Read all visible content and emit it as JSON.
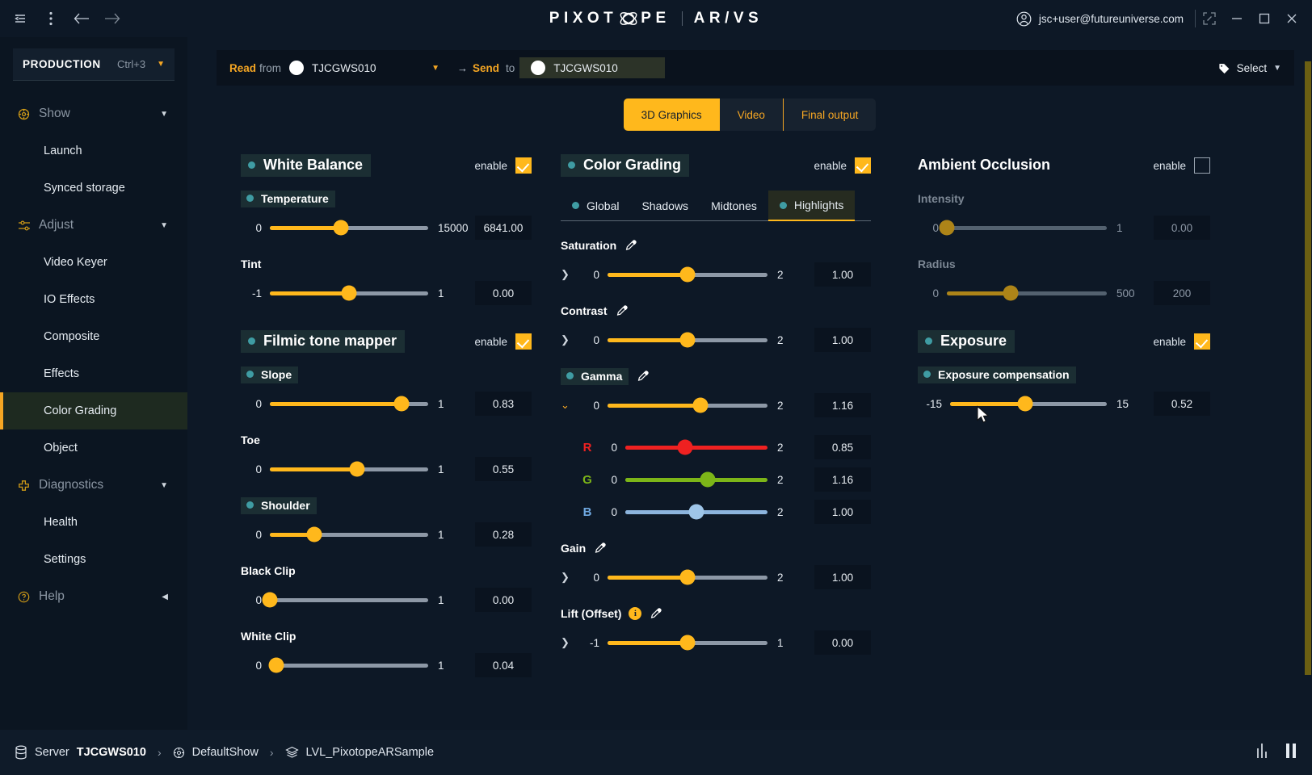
{
  "titlebar": {
    "collapse_icon": "collapse-panel-icon",
    "menu_icon": "kebab-menu-icon",
    "back_icon": "arrow-left-icon",
    "forward_icon": "arrow-right-icon",
    "logo_text": "PIXOT",
    "logo_text_tail": "PE",
    "logo_sub": "AR/VS",
    "user_email": "jsc+user@futureuniverse.com",
    "fullscreen_icon": "expand-icon",
    "minimize_icon": "minimize-icon",
    "maximize_icon": "maximize-icon",
    "close_icon": "close-icon"
  },
  "sidebar": {
    "production": {
      "label": "PRODUCTION",
      "shortcut": "Ctrl+3"
    },
    "groups": [
      {
        "label": "Show",
        "icon": "show-icon",
        "items": [
          "Launch",
          "Synced storage"
        ]
      },
      {
        "label": "Adjust",
        "icon": "sliders-icon",
        "items": [
          "Video Keyer",
          "IO Effects",
          "Composite",
          "Effects",
          "Color Grading",
          "Object"
        ]
      },
      {
        "label": "Diagnostics",
        "icon": "diagnostics-icon",
        "items": [
          "Health",
          "Settings"
        ]
      }
    ],
    "help": {
      "label": "Help",
      "icon": "help-icon"
    },
    "active_item": "Color Grading"
  },
  "topbar": {
    "read_from_label": "Read",
    "read_from_sub": "from",
    "read_from_value": "TJCGWS010",
    "arrow": "→",
    "send_to_label": "Send",
    "send_to_sub": "to",
    "send_to_value": "TJCGWS010",
    "select_label": "Select",
    "tag_icon": "tag-icon"
  },
  "view_tabs": [
    {
      "label": "3D Graphics",
      "active": true
    },
    {
      "label": "Video",
      "active": false
    },
    {
      "label": "Final output",
      "active": false
    }
  ],
  "white_balance": {
    "title": "White Balance",
    "enable_label": "enable",
    "enabled": true,
    "params": [
      {
        "name": "Temperature",
        "chip": true,
        "min": "0",
        "max": "15000",
        "value": "6841.00",
        "pct": 45
      },
      {
        "name": "Tint",
        "chip": false,
        "min": "-1",
        "max": "1",
        "value": "0.00",
        "pct": 50
      }
    ]
  },
  "filmic": {
    "title": "Filmic tone mapper",
    "enable_label": "enable",
    "enabled": true,
    "params": [
      {
        "name": "Slope",
        "chip": true,
        "min": "0",
        "max": "1",
        "value": "0.83",
        "pct": 83
      },
      {
        "name": "Toe",
        "chip": false,
        "min": "0",
        "max": "1",
        "value": "0.55",
        "pct": 55
      },
      {
        "name": "Shoulder",
        "chip": true,
        "min": "0",
        "max": "1",
        "value": "0.28",
        "pct": 28
      },
      {
        "name": "Black Clip",
        "chip": false,
        "min": "0",
        "max": "1",
        "value": "0.00",
        "pct": 0
      },
      {
        "name": "White Clip",
        "chip": false,
        "min": "0",
        "max": "1",
        "value": "0.04",
        "pct": 4
      }
    ]
  },
  "color_grading": {
    "title": "Color Grading",
    "enable_label": "enable",
    "enabled": true,
    "tabs": [
      {
        "label": "Global",
        "dot": true,
        "active": false
      },
      {
        "label": "Shadows",
        "dot": false,
        "active": false
      },
      {
        "label": "Midtones",
        "dot": false,
        "active": false
      },
      {
        "label": "Highlights",
        "dot": true,
        "active": true
      }
    ],
    "params": [
      {
        "name": "Saturation",
        "chip": false,
        "eyedropper": true,
        "info": false,
        "expander": "collapsed",
        "min": "0",
        "max": "2",
        "value": "1.00",
        "pct": 50
      },
      {
        "name": "Contrast",
        "chip": false,
        "eyedropper": true,
        "info": false,
        "expander": "collapsed",
        "min": "0",
        "max": "2",
        "value": "1.00",
        "pct": 50
      },
      {
        "name": "Gamma",
        "chip": true,
        "eyedropper": true,
        "info": false,
        "expander": "expanded",
        "min": "0",
        "max": "2",
        "value": "1.16",
        "pct": 58,
        "channels": [
          {
            "ch": "R",
            "min": "0",
            "max": "2",
            "value": "0.85",
            "pct": 42
          },
          {
            "ch": "G",
            "min": "0",
            "max": "2",
            "value": "1.16",
            "pct": 58
          },
          {
            "ch": "B",
            "min": "0",
            "max": "2",
            "value": "1.00",
            "pct": 50
          }
        ]
      },
      {
        "name": "Gain",
        "chip": false,
        "eyedropper": true,
        "info": false,
        "expander": "collapsed",
        "min": "0",
        "max": "2",
        "value": "1.00",
        "pct": 50
      },
      {
        "name": "Lift (Offset)",
        "chip": false,
        "eyedropper": true,
        "info": true,
        "expander": "collapsed",
        "min": "-1",
        "max": "1",
        "value": "0.00",
        "pct": 50
      }
    ]
  },
  "ambient_occlusion": {
    "title": "Ambient Occlusion",
    "enable_label": "enable",
    "enabled": false,
    "params": [
      {
        "name": "Intensity",
        "chip": false,
        "min": "0",
        "max": "1",
        "value": "0.00",
        "pct": 0
      },
      {
        "name": "Radius",
        "chip": false,
        "min": "0",
        "max": "500",
        "value": "200",
        "pct": 40
      }
    ]
  },
  "exposure": {
    "title": "Exposure",
    "enable_label": "enable",
    "enabled": true,
    "params": [
      {
        "name": "Exposure compensation",
        "chip": true,
        "min": "-15",
        "max": "15",
        "value": "0.52",
        "pct": 48
      }
    ]
  },
  "statusbar": {
    "server_icon": "database-icon",
    "server_label": "Server",
    "server_name": "TJCGWS010",
    "sep": "›",
    "show_icon": "show-icon",
    "show_name": "DefaultShow",
    "level_icon": "layers-icon",
    "level_name": "LVL_PixotopeARSample",
    "signal_icon": "signal-icon",
    "pause_icon": "pause-icon"
  }
}
